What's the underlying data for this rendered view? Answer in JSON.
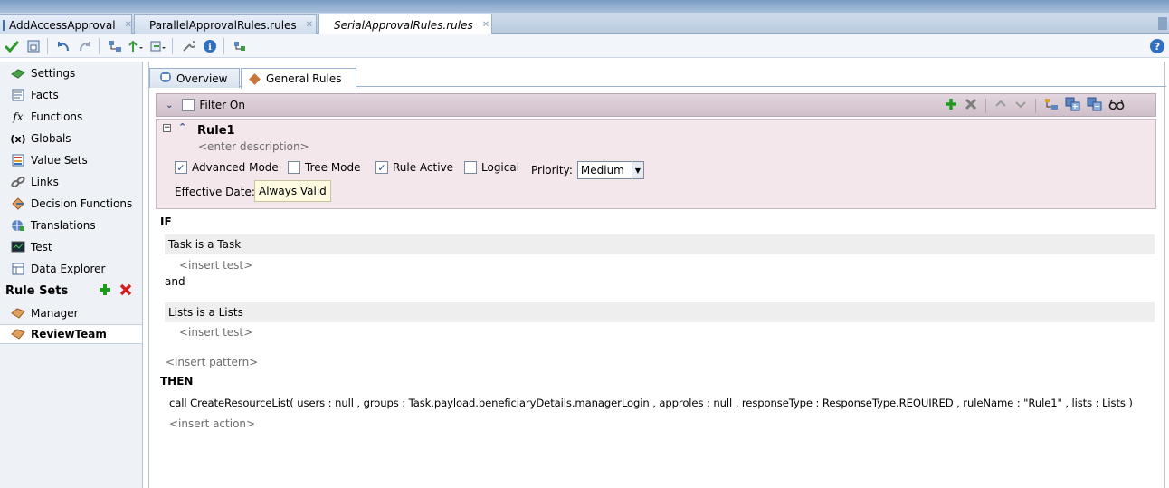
{
  "editor_tabs": [
    {
      "label": "AddAccessApproval"
    },
    {
      "label": "ParallelApprovalRules.rules"
    },
    {
      "label": "SerialApprovalRules.rules"
    }
  ],
  "sidebar": {
    "items": [
      {
        "label": "Settings"
      },
      {
        "label": "Facts"
      },
      {
        "label": "Functions"
      },
      {
        "label": "Globals"
      },
      {
        "label": "Value Sets"
      },
      {
        "label": "Links"
      },
      {
        "label": "Decision Functions"
      },
      {
        "label": "Translations"
      },
      {
        "label": "Test"
      },
      {
        "label": "Data Explorer"
      }
    ],
    "rule_sets_label": "Rule Sets",
    "rule_sets": [
      {
        "label": "Manager"
      },
      {
        "label": "ReviewTeam"
      }
    ]
  },
  "subtabs": [
    {
      "label": "Overview"
    },
    {
      "label": "General Rules"
    }
  ],
  "filter": {
    "label": "Filter On",
    "checked": false
  },
  "rule": {
    "name": "Rule1",
    "description_placeholder": "<enter description>",
    "advanced_mode_label": "Advanced Mode",
    "advanced_mode": true,
    "tree_mode_label": "Tree Mode",
    "tree_mode": false,
    "rule_active_label": "Rule Active",
    "rule_active": true,
    "logical_label": "Logical",
    "logical": false,
    "priority_label": "Priority:",
    "priority_value": "Medium",
    "effective_date_label": "Effective Date:",
    "effective_date_value": "Always Valid"
  },
  "body": {
    "if_label": "IF",
    "pattern1": "Task is a Task",
    "insert_test1": "<insert test>",
    "and_label": "and",
    "pattern2": "Lists is a Lists",
    "insert_test2": "<insert test>",
    "insert_pattern": "<insert pattern>",
    "then_label": "THEN",
    "action": "call CreateResourceList( users : null , groups : Task.payload.beneficiaryDetails.managerLogin , approles : null , responseType : ResponseType.REQUIRED , ruleName : \"Rule1\" , lists : Lists )",
    "insert_action": "<insert action>"
  },
  "colors": {
    "accent_blue": "#1e4f9a",
    "add_green": "#1f9a1f",
    "delete_red": "#d22020",
    "rule_panel_bg": "#f3e7ec"
  }
}
